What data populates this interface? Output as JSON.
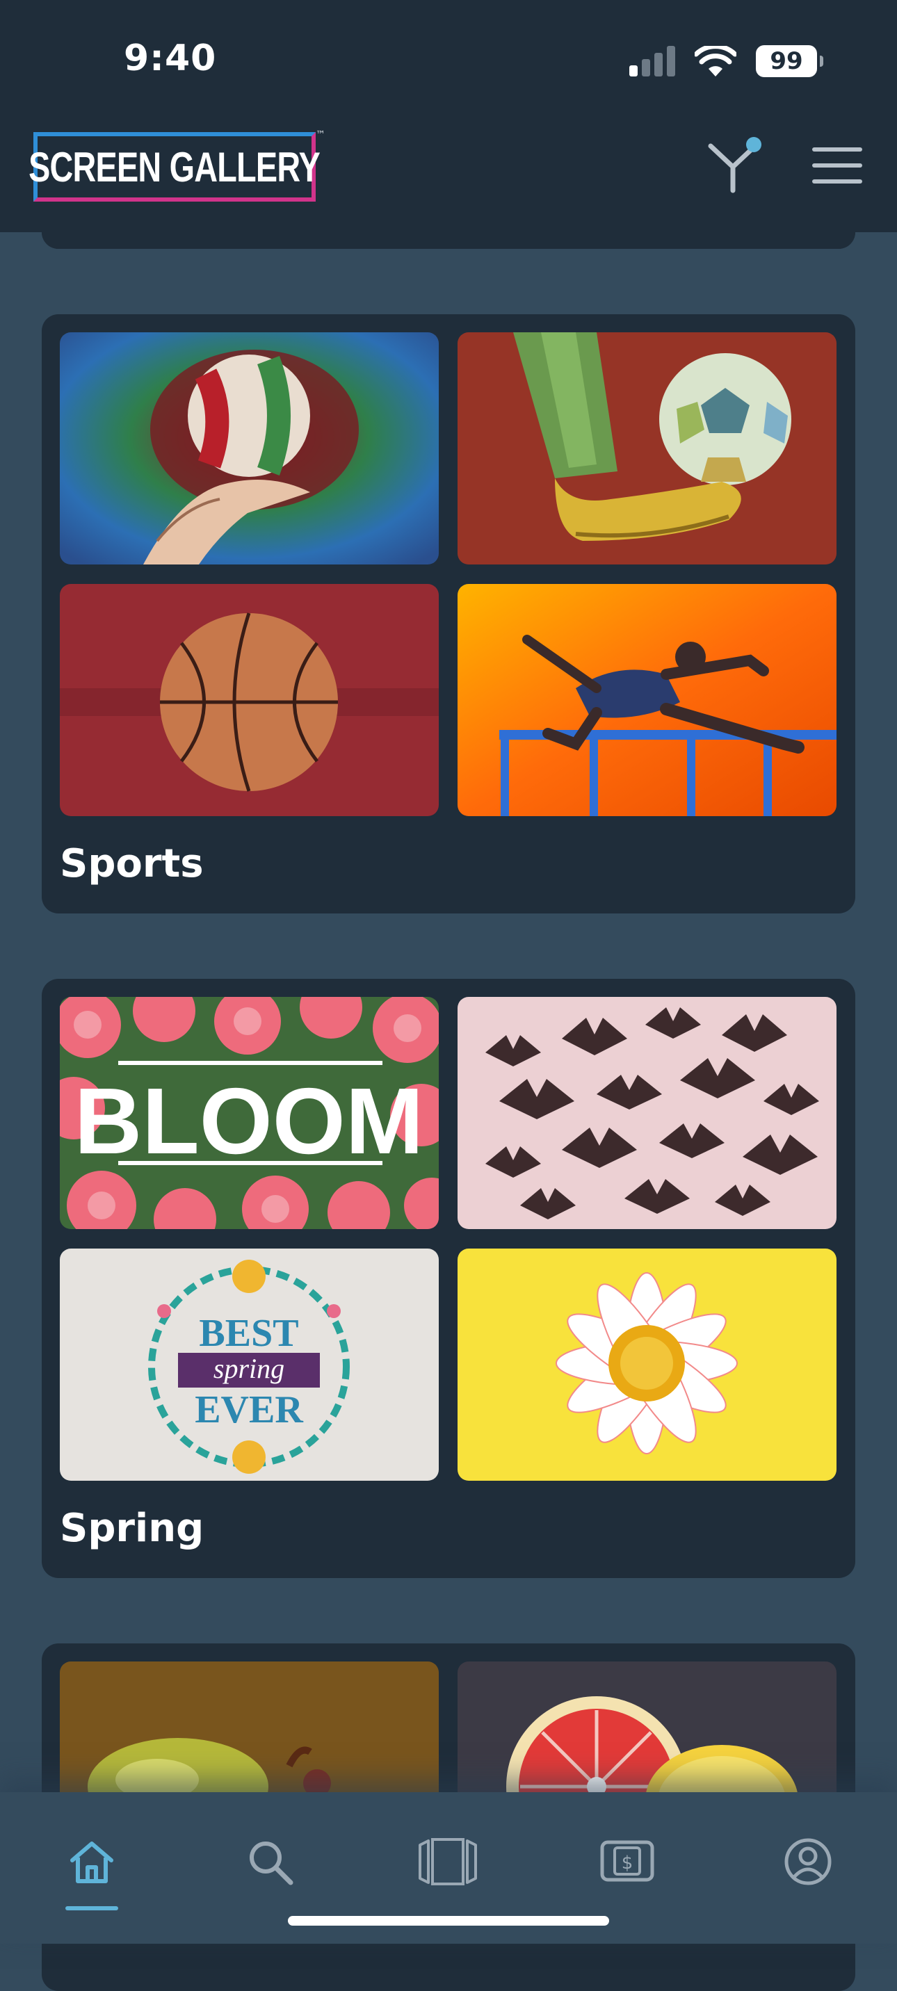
{
  "status_bar": {
    "time": "9:40",
    "battery": "99"
  },
  "header": {
    "logo_text": "SCREEN GALLERY",
    "logo_mark": "™"
  },
  "collections": [
    {
      "title": "Sports",
      "thumbnails": [
        "volleyball-painting",
        "soccer-ball-painting",
        "basketball-painting",
        "hurdler-painting"
      ]
    },
    {
      "title": "Spring",
      "thumbnails": [
        "bloom-flowers",
        "butterflies",
        "best-spring-ever",
        "daisy-on-yellow"
      ],
      "bloom_text": "BLOOM",
      "best_text": "BEST",
      "spring_text": "spring",
      "ever_text": "EVER"
    },
    {
      "title": "",
      "thumbnails": [
        "pear-painting",
        "grapefruit-painting"
      ]
    }
  ],
  "bottom_nav": {
    "items": [
      {
        "icon": "home-icon",
        "active": true
      },
      {
        "icon": "search-icon",
        "active": false
      },
      {
        "icon": "carousel-icon",
        "active": false
      },
      {
        "icon": "money-screen-icon",
        "active": false
      },
      {
        "icon": "profile-icon",
        "active": false
      }
    ],
    "active_color": "#5fb4d9"
  },
  "colors": {
    "background": "#344b5d",
    "card": "#1f2d3a",
    "accent": "#5fb4d9"
  }
}
